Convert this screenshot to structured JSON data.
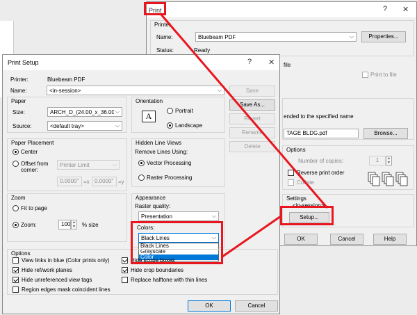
{
  "print": {
    "title": "Print",
    "help": "?",
    "close": "✕",
    "printer_group": "Printer",
    "name_label": "Name:",
    "name_value": "Bluebeam PDF",
    "properties_btn": "Properties...",
    "status_label": "Status:",
    "status_value": "Ready",
    "file_text": "file",
    "print_to_file": "Print to file",
    "sended_text": "ended to the specified name",
    "file_name": "TAGE BLDG.pdf",
    "browse_btn": "Browse...",
    "options_group": "Options",
    "copies_label": "Number of copies:",
    "copies_value": "1",
    "reverse_label": "Reverse print order",
    "collate_label": "Collate",
    "settings_group": "Settings",
    "settings_value": "<in-session>",
    "setup_btn": "Setup...",
    "ok_btn": "OK",
    "cancel_btn": "Cancel",
    "help_btn": "Help"
  },
  "setup": {
    "title": "Print Setup",
    "help": "?",
    "close": "✕",
    "printer_label": "Printer:",
    "printer_value": "Bluebeam PDF",
    "name_label": "Name:",
    "name_value": "<in-session>",
    "save_btn": "Save",
    "save_as_btn": "Save As...",
    "revert_btn": "Revert",
    "rename_btn": "Rename",
    "delete_btn": "Delete",
    "paper_group": "Paper",
    "size_label": "Size:",
    "size_value": "ARCH_D_(24.00_x_36.00_",
    "source_label": "Source:",
    "source_value": "<default tray>",
    "orientation_group": "Orientation",
    "orientation_icon": "A",
    "portrait": "Portrait",
    "landscape": "Landscape",
    "placement_group": "Paper Placement",
    "center": "Center",
    "offset": "Offset from corner:",
    "printer_limit": "Printer Limit",
    "offset_x": "0.0000\"",
    "offset_x_unit": "=x",
    "offset_y": "0.0000\"",
    "offset_y_unit": "=y",
    "hidden_group": "Hidden Line Views",
    "remove_lines": "Remove Lines Using:",
    "vector": "Vector Processing",
    "raster": "Raster Processing",
    "zoom_group": "Zoom",
    "fit_page": "Fit to page",
    "zoom_label": "Zoom:",
    "zoom_value": "100",
    "zoom_unit": "% size",
    "appearance_group": "Appearance",
    "raster_quality": "Raster quality:",
    "raster_value": "Presentation",
    "colors_label": "Colors:",
    "colors_value": "Black Lines",
    "colors_options": [
      "Black Lines",
      "Grayscale",
      "Color"
    ],
    "options_group": "Options",
    "opt_view_links": "View links in blue (Color prints only)",
    "opt_hide_ref": "Hide ref/work planes",
    "opt_hide_unref": "Hide unreferenced view tags",
    "opt_region": "Region edges mask coincident lines",
    "opt_hide_scope": "Hide scope boxes",
    "opt_hide_crop": "Hide crop boundaries",
    "opt_replace": "Replace halftone with thin lines",
    "ok_btn": "OK",
    "cancel_btn": "Cancel"
  },
  "colors": {
    "highlight": "#e8161e",
    "selection": "#0078d7"
  }
}
